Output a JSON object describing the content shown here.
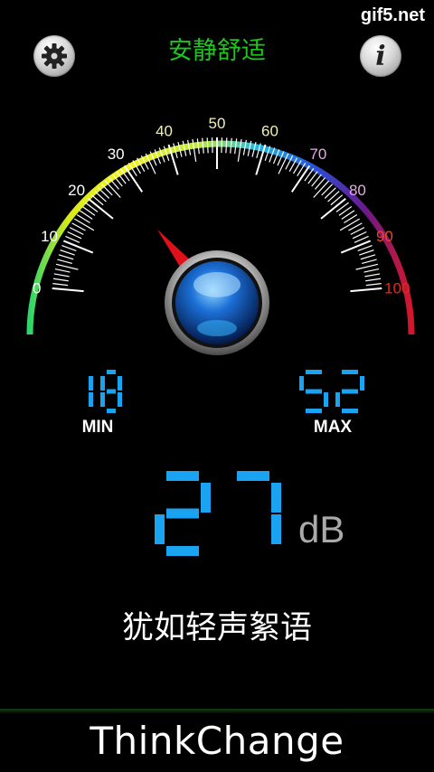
{
  "header": {
    "title": "安静舒适",
    "title_color": "#1ec51e",
    "settings_icon": "gear-icon",
    "info_icon": "info-icon",
    "info_glyph": "i"
  },
  "watermark": {
    "text": "gif5.net"
  },
  "gauge": {
    "tick_labels": [
      "0",
      "10",
      "20",
      "30",
      "40",
      "50",
      "60",
      "70",
      "80",
      "90",
      "100"
    ],
    "needle_value": 27
  },
  "readings": {
    "min_value": "18",
    "min_label": "MIN",
    "max_value": "52",
    "max_label": "MAX",
    "current_value": "27",
    "unit": "dB",
    "digit_color": "#1aa3f0"
  },
  "description": "犹如轻声絮语",
  "footer": {
    "brand": "ThinkChange"
  }
}
